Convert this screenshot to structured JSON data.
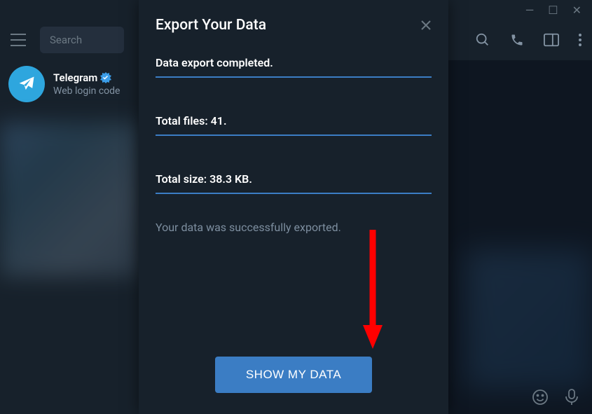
{
  "window": {
    "minimize": "—",
    "maximize": "☐",
    "close": "✕"
  },
  "header": {
    "search_placeholder": "Search"
  },
  "sidebar": {
    "chat": {
      "name": "Telegram",
      "preview": "Web login code"
    }
  },
  "modal": {
    "title": "Export Your Data",
    "status": "Data export completed.",
    "files_line": "Total files: 41.",
    "size_line": "Total size: 38.3 KB.",
    "success": "Your data was successfully exported.",
    "button": "SHOW MY DATA"
  }
}
